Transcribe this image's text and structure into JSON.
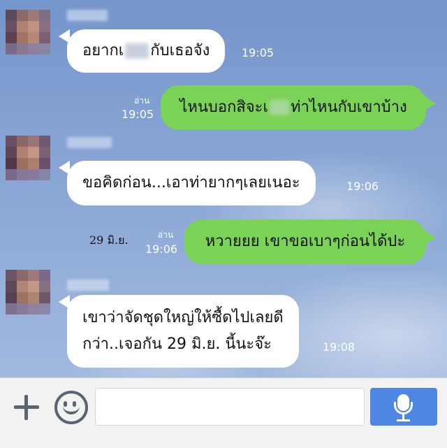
{
  "messages": [
    {
      "side": "in",
      "parts": [
        "อยากเ",
        "กับเธอจัง"
      ],
      "time": "19:05"
    },
    {
      "side": "out",
      "read": "อ่าน",
      "parts": [
        "ไหนบอกสิจะเ",
        "ท่าไหนกับเขาบ้าง"
      ],
      "time": "19:05"
    },
    {
      "side": "in",
      "text": "ขอคิดก่อน...เอาท่ายากๆเลยเนอะ",
      "time": "19:06"
    },
    {
      "side": "out",
      "read": "อ่าน",
      "text": "หวายยย เขาขอเบาๆก่อนได้ปะ",
      "time": "19:06"
    },
    {
      "side": "in",
      "lines": [
        "เขาว่าจัดชุดใหญ่ให้ซื้ดไปเลยดี",
        "กว่า..เจอกัน  29 มิ.ย. นี้นะจ๊ะ"
      ],
      "time": "19:08"
    }
  ],
  "annotation": "29 มิ.ย.",
  "composer": {
    "placeholder": ""
  },
  "icons": {
    "plus": "plus-icon",
    "emoji": "smiley-icon",
    "mic": "microphone-icon"
  },
  "colors": {
    "incoming": "#ffffff",
    "outgoing": "#7ad257",
    "send": "#4d86e4"
  }
}
